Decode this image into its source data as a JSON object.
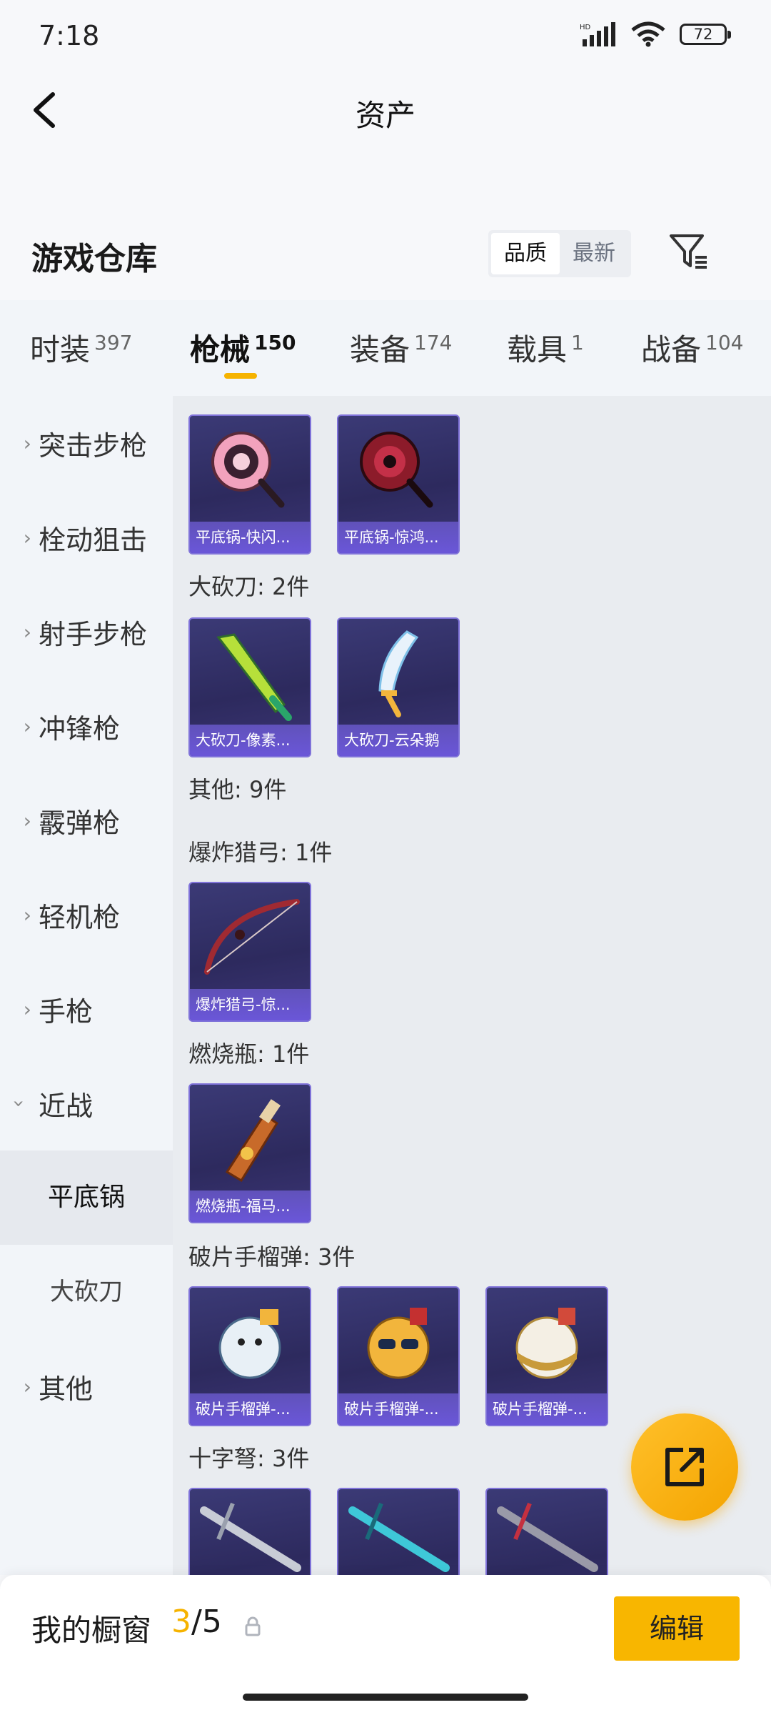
{
  "status_bar": {
    "time": "7:18",
    "battery": "72"
  },
  "header": {
    "title": "资产"
  },
  "warehouse": {
    "title": "游戏仓库",
    "sort_options": [
      "品质",
      "最新"
    ],
    "active_sort": "品质"
  },
  "tabs": [
    {
      "label": "时装",
      "count": "397"
    },
    {
      "label": "枪械",
      "count": "150",
      "active": true
    },
    {
      "label": "装备",
      "count": "174"
    },
    {
      "label": "载具",
      "count": "1"
    },
    {
      "label": "战备",
      "count": "104"
    }
  ],
  "sidebar": {
    "categories": [
      "突击步枪",
      "栓动狙击",
      "射手步枪",
      "冲锋枪",
      "霰弹枪",
      "轻机枪",
      "手枪",
      "近战",
      "其他"
    ],
    "subcategories": [
      "平底锅",
      "大砍刀"
    ],
    "active_subcategory": "平底锅"
  },
  "sections": [
    {
      "title": "",
      "items": [
        "平底锅-快闪...",
        "平底锅-惊鸿..."
      ]
    },
    {
      "title": "大砍刀: 2件",
      "items": [
        "大砍刀-像素...",
        "大砍刀-云朵鹅"
      ]
    },
    {
      "title": "其他: 9件",
      "items": []
    },
    {
      "title": "爆炸猎弓: 1件",
      "items": [
        "爆炸猎弓-惊..."
      ]
    },
    {
      "title": "燃烧瓶: 1件",
      "items": [
        "燃烧瓶-福马..."
      ]
    },
    {
      "title": "破片手榴弹: 3件",
      "items": [
        "破片手榴弹-...",
        "破片手榴弹-...",
        "破片手榴弹-..."
      ]
    },
    {
      "title": "十字弩: 3件",
      "items": []
    }
  ],
  "bottom_bar": {
    "label": "我的橱窗",
    "current": "3",
    "total": "/5",
    "edit_label": "编辑"
  },
  "colors": {
    "accent": "#f6b300",
    "card_bg": "#2f2c64",
    "card_border": "#7f72d9",
    "sidebar_bg": "#f2f5f9",
    "content_bg": "#e9ecf0"
  }
}
